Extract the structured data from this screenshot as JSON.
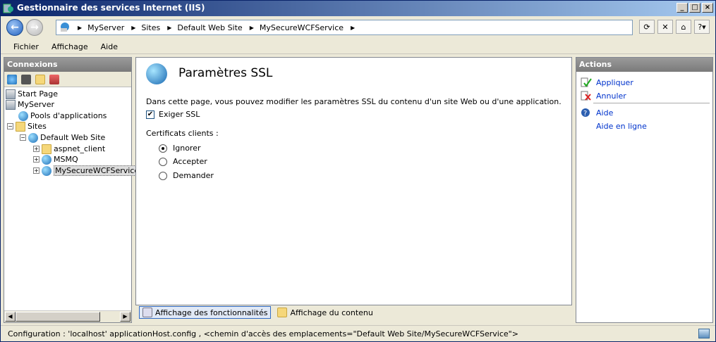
{
  "window": {
    "title": "Gestionnaire des services Internet (IIS)"
  },
  "address": {
    "crumbs": [
      "MyServer",
      "Sites",
      "Default Web Site",
      "MySecureWCFService"
    ]
  },
  "menu": {
    "items": [
      "Fichier",
      "Affichage",
      "Aide"
    ]
  },
  "connections": {
    "header": "Connexions",
    "tree": [
      {
        "label": "Start Page"
      },
      {
        "label": "MyServer"
      },
      {
        "label": "Pools d'applications"
      },
      {
        "label": "Sites"
      },
      {
        "label": "Default Web Site"
      },
      {
        "label": "aspnet_client"
      },
      {
        "label": "MSMQ"
      },
      {
        "label": "MySecureWCFService"
      }
    ]
  },
  "main": {
    "title": "Paramètres SSL",
    "description": "Dans cette page, vous pouvez modifier les paramètres SSL du contenu d'un site Web ou d'une application.",
    "require_ssl": {
      "label": "Exiger SSL",
      "checked": true
    },
    "client_certs_label": "Certificats clients :",
    "options": [
      {
        "label": "Ignorer",
        "selected": true
      },
      {
        "label": "Accepter",
        "selected": false
      },
      {
        "label": "Demander",
        "selected": false
      }
    ]
  },
  "view_tabs": {
    "features": "Affichage des fonctionnalités",
    "content": "Affichage du contenu"
  },
  "actions": {
    "header": "Actions",
    "apply": "Appliquer",
    "cancel": "Annuler",
    "help": "Aide",
    "online_help": "Aide en ligne"
  },
  "status": {
    "text": "Configuration : 'localhost' applicationHost.config , <chemin d'accès des emplacements=\"Default Web Site/MySecureWCFService\">"
  }
}
